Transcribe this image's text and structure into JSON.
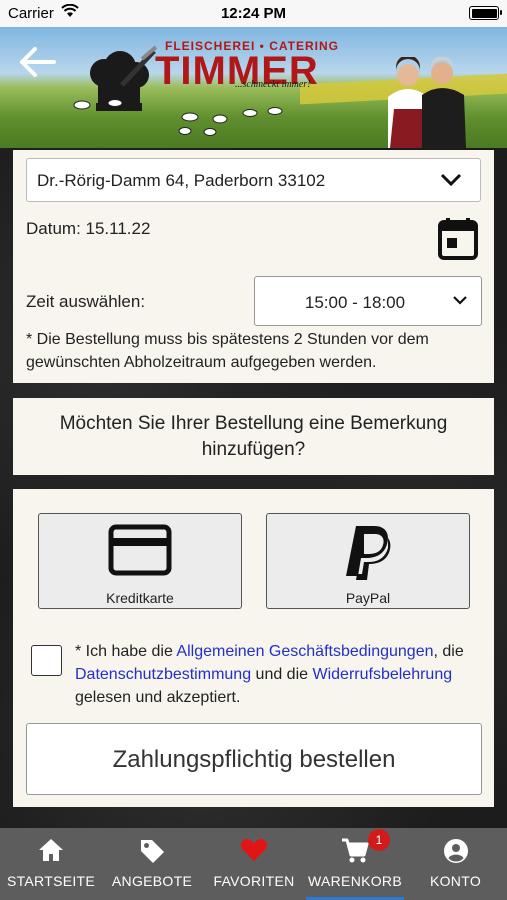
{
  "status_bar": {
    "carrier": "Carrier",
    "time": "12:24 PM"
  },
  "header": {
    "logo_subtitle": "FLEISCHEREI • CATERING",
    "logo_title": "TIMMER",
    "logo_slogan": "...schmeckt immer!"
  },
  "pickup": {
    "address": "Dr.-Rörig-Damm 64, Paderborn 33102",
    "date_label": "Datum: 15.11.22",
    "time_label": "Zeit auswählen:",
    "time_value": "15:00 - 18:00",
    "note": "* Die Bestellung muss bis spätestens 2 Stunden vor dem gewünschten Abholzeitraum aufgegeben werden."
  },
  "remark": {
    "question": "Möchten Sie Ihrer Bestellung eine Bemerkung hinzufügen?"
  },
  "payment": {
    "credit_label": "Kreditkarte",
    "paypal_label": "PayPal",
    "terms_prefix": "* Ich habe die ",
    "terms_link1": "Allgemeinen Geschäftsbedingungen",
    "terms_sep1": ", die ",
    "terms_link2": "Datenschutzbestimmung",
    "terms_sep2": " und die ",
    "terms_link3": "Widerrufsbelehrung",
    "terms_suffix": " gelesen und akzeptiert.",
    "order_button": "Zahlungspflichtig bestellen"
  },
  "tabs": [
    {
      "label": "STARTSEITE",
      "icon": "home-icon"
    },
    {
      "label": "ANGEBOTE",
      "icon": "tag-icon"
    },
    {
      "label": "FAVORITEN",
      "icon": "heart-icon"
    },
    {
      "label": "WARENKORB",
      "icon": "cart-icon",
      "badge": "1"
    },
    {
      "label": "KONTO",
      "icon": "account-icon"
    }
  ],
  "colors": {
    "link": "#2230c8",
    "brand_red": "#b01818",
    "favorite_heart": "#e01616",
    "badge": "#d21a1a",
    "active_tab_indicator": "#2b7bd6",
    "tab_bar": "#5d5d5d"
  }
}
